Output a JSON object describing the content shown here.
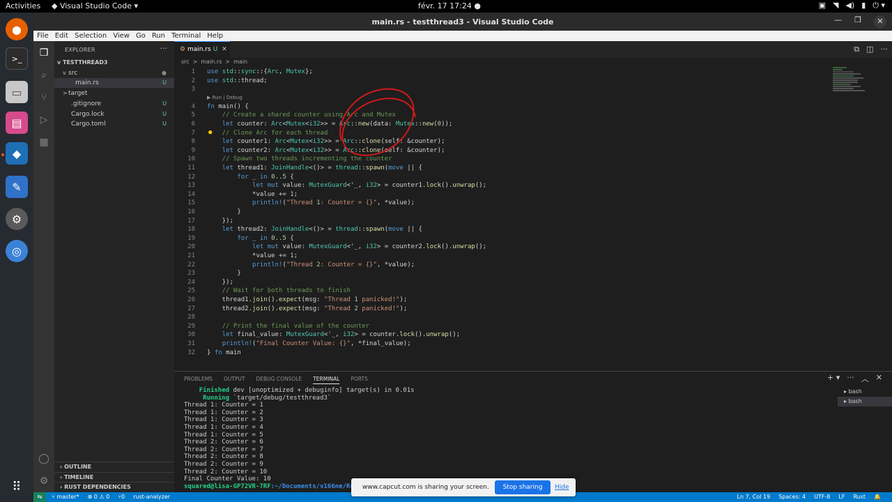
{
  "system": {
    "activities": "Activities",
    "app_name": "Visual Studio Code",
    "clock": "févr. 17  17:24"
  },
  "window": {
    "title": "main.rs - testthread3 - Visual Studio Code"
  },
  "menu": [
    "File",
    "Edit",
    "Selection",
    "View",
    "Go",
    "Run",
    "Terminal",
    "Help"
  ],
  "explorer": {
    "header": "EXPLORER",
    "project": "TESTTHREAD3",
    "items": [
      {
        "label": "src",
        "badge": "",
        "chev": "v"
      },
      {
        "label": "main.rs",
        "badge": "U",
        "chev": ""
      },
      {
        "label": "target",
        "badge": "",
        "chev": ">"
      },
      {
        "label": ".gitignore",
        "badge": "U",
        "chev": ""
      },
      {
        "label": "Cargo.lock",
        "badge": "U",
        "chev": ""
      },
      {
        "label": "Cargo.toml",
        "badge": "U",
        "chev": ""
      }
    ],
    "sections": [
      "OUTLINE",
      "TIMELINE",
      "RUST DEPENDENCIES"
    ]
  },
  "editor": {
    "tab": {
      "name": "main.rs",
      "status": "U"
    },
    "breadcrumb": [
      "src",
      ">",
      "main.rs",
      ">",
      "main"
    ],
    "codelens": "▶ Run | Debug"
  },
  "code_lines": [
    "use std::sync::{Arc, Mutex};",
    "use std::thread;",
    "",
    "fn main() {",
    "    // Create a shared counter using Arc and Mutex",
    "    let counter: Arc<Mutex<i32>> = Arc::new(data: Mutex::new(0));",
    "    // Clone Arc for each thread",
    "    let counter1: Arc<Mutex<i32>> = Arc::clone(self: &counter);",
    "    let counter2: Arc<Mutex<i32>> = Arc::clone(self: &counter);",
    "    // Spawn two threads incrementing the counter",
    "    let thread1: JoinHandle<()> = thread::spawn(move || {",
    "        for _ in 0..5 {",
    "            let mut value: MutexGuard<'_, i32> = counter1.lock().unwrap();",
    "            *value += 1;",
    "            println!(\"Thread 1: Counter = {}\", *value);",
    "        }",
    "    });",
    "    let thread2: JoinHandle<()> = thread::spawn(move || {",
    "        for _ in 0..5 {",
    "            let mut value: MutexGuard<'_, i32> = counter2.lock().unwrap();",
    "            *value += 1;",
    "            println!(\"Thread 2: Counter = {}\", *value);",
    "        }",
    "    });",
    "    // Wait for both threads to finish",
    "    thread1.join().expect(msg: \"Thread 1 panicked!\");",
    "    thread2.join().expect(msg: \"Thread 2 panicked!\");",
    "",
    "    // Print the final value of the counter",
    "    let final_value: MutexGuard<'_, i32> = counter.lock().unwrap();",
    "    println!(\"Final Counter Value: {}\", *final_value);",
    "} fn main"
  ],
  "panel": {
    "tabs": [
      "PROBLEMS",
      "OUTPUT",
      "DEBUG CONSOLE",
      "TERMINAL",
      "PORTS"
    ],
    "active_tab": "TERMINAL",
    "finished": {
      "word": "Finished",
      "rest": " dev [unoptimized + debuginfo] target(s) in 0.01s"
    },
    "running": {
      "word": "Running",
      "rest": " `target/debug/testthread3`"
    },
    "output": [
      "Thread 1: Counter = 1",
      "Thread 1: Counter = 2",
      "Thread 1: Counter = 3",
      "Thread 1: Counter = 4",
      "Thread 1: Counter = 5",
      "Thread 2: Counter = 6",
      "Thread 2: Counter = 7",
      "Thread 2: Counter = 8",
      "Thread 2: Counter = 9",
      "Thread 2: Counter = 10",
      "Final Counter Value: 10"
    ],
    "prompt_user": "squared@lisa-GP72VR-7RF",
    "prompt_path": ":~/Documents/v166ne/Ru",
    "sessions": [
      "bash",
      "bash"
    ]
  },
  "status": {
    "branch": "master*",
    "problems": "⊗ 0 ⚠ 0",
    "ports": "⑂0",
    "extension": "rust-analyzer",
    "cursor": "Ln 7, Col 19",
    "spaces": "Spaces: 4",
    "encoding": "UTF-8",
    "eol": "LF",
    "language": "Rust"
  },
  "share_banner": {
    "message": "www.capcut.com is sharing your screen.",
    "stop": "Stop sharing",
    "hide": "Hide"
  },
  "colors": {
    "accent": "#007acc",
    "comment": "#6a9955",
    "keyword": "#569cd6",
    "annotation": "#d01a1a"
  }
}
